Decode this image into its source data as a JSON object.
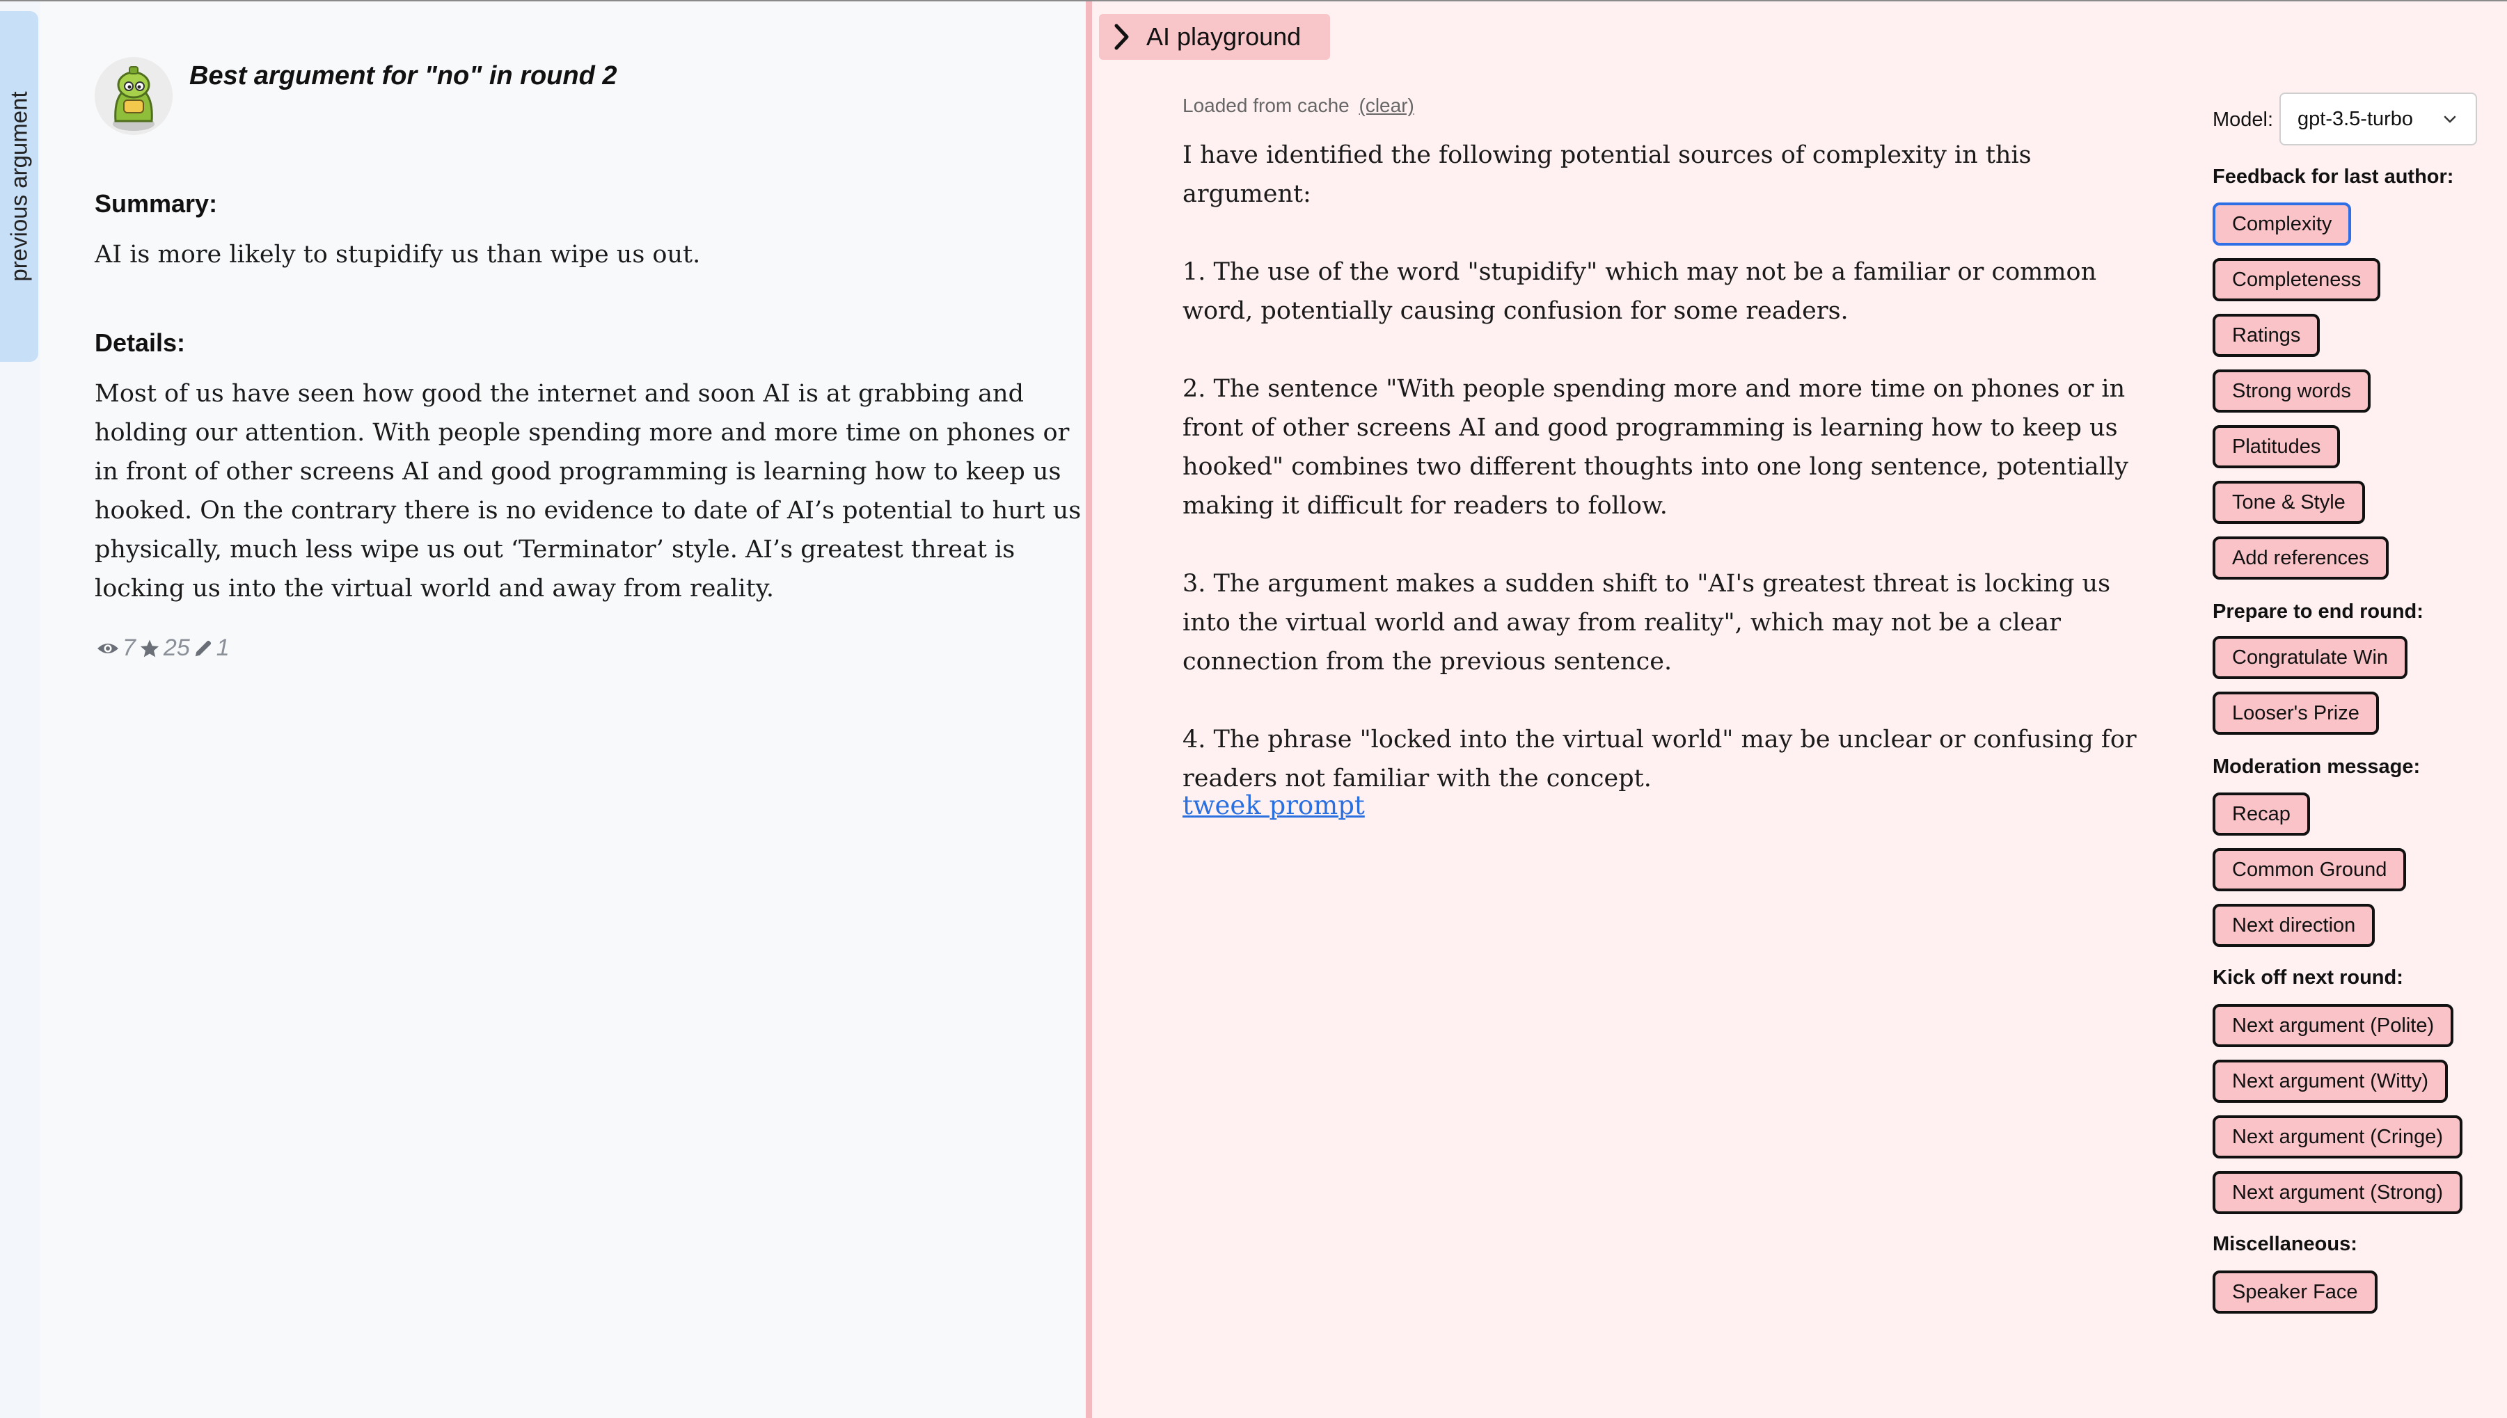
{
  "nav": {
    "previous_label": "previous argument"
  },
  "argument": {
    "title": "Best argument for \"no\" in round 2",
    "summary_heading": "Summary:",
    "summary": "AI is more likely to stupidify us than wipe us out.",
    "details_heading": "Details:",
    "details": "Most of us have seen how good the internet and soon AI is at grabbing and holding our attention. With people spending more and more time on phones or in front of other screens AI and good programming is learning how to keep us hooked. On the contrary there is no evidence to date of AI’s potential to hurt us physically, much less wipe us out ‘Terminator’ style. AI’s greatest threat is locking us into the virtual world and away from reality.",
    "stats": {
      "views": "7",
      "stars": "25",
      "edits": "1"
    }
  },
  "playground": {
    "tab_label": "AI playground",
    "cache_text": "Loaded from cache",
    "cache_clear": "(clear)",
    "response": [
      "I have identified the following potential sources of complexity in this argument:",
      "1. The use of the word \"stupidify\" which may not be a familiar or common word, potentially causing confusion for some readers.",
      "2. The sentence \"With people spending more and more time on phones or in front of other screens AI and good programming is learning how to keep us hooked\" combines two different thoughts into one long sentence, potentially making it difficult for readers to follow.",
      "3. The argument makes a sudden shift to \"AI's greatest threat is locking us into the virtual world and away from reality\", which may not be a clear connection from the previous sentence.",
      "4. The phrase \"locked into the virtual world\" may be unclear or confusing for readers not familiar with the concept."
    ],
    "tweak_label": "tweek prompt"
  },
  "controls": {
    "model_label": "Model:",
    "model_value": "gpt-3.5-turbo",
    "groups": [
      {
        "label": "Feedback for last author:",
        "buttons": [
          "Complexity",
          "Completeness",
          "Ratings",
          "Strong words",
          "Platitudes",
          "Tone & Style",
          "Add references"
        ]
      },
      {
        "label": "Prepare to end round:",
        "buttons": [
          "Congratulate Win",
          "Looser's Prize"
        ]
      },
      {
        "label": "Moderation message:",
        "buttons": [
          "Recap",
          "Common Ground",
          "Next direction"
        ]
      },
      {
        "label": "Kick off next round:",
        "buttons": [
          "Next argument (Polite)",
          "Next argument (Witty)",
          "Next argument (Cringe)",
          "Next argument (Strong)"
        ]
      },
      {
        "label": "Miscellaneous:",
        "buttons": [
          "Speaker Face"
        ]
      }
    ],
    "active_button": "Complexity"
  }
}
